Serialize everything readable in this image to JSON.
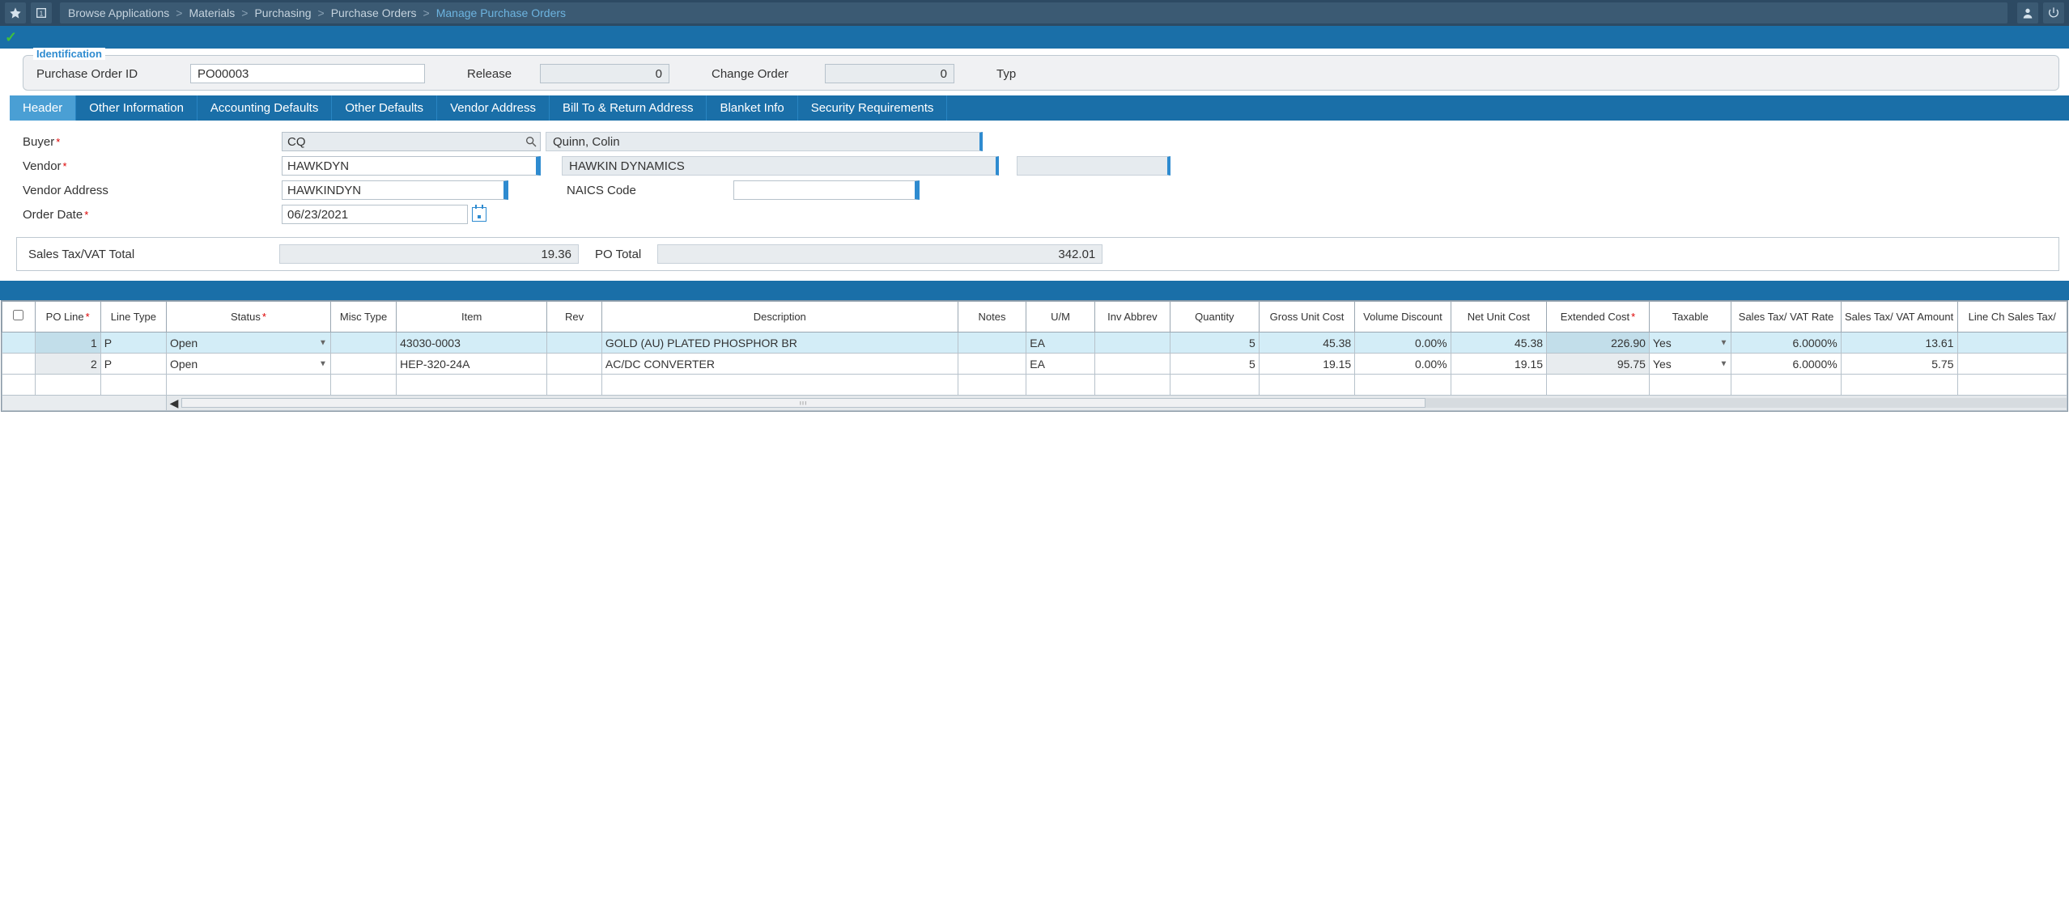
{
  "topbar": {
    "breadcrumbs": {
      "root": "Browse Applications",
      "items": [
        "Materials",
        "Purchasing",
        "Purchase Orders"
      ],
      "current": "Manage Purchase Orders"
    }
  },
  "identification": {
    "legend": "Identification",
    "po_id_label": "Purchase Order ID",
    "po_id_value": "PO00003",
    "release_label": "Release",
    "release_value": "0",
    "change_order_label": "Change Order",
    "change_order_value": "0",
    "type_label": "Typ"
  },
  "tabs": [
    "Header",
    "Other Information",
    "Accounting Defaults",
    "Other Defaults",
    "Vendor Address",
    "Bill To & Return Address",
    "Blanket Info",
    "Security Requirements"
  ],
  "form": {
    "buyer_label": "Buyer",
    "buyer_code": "CQ",
    "buyer_name": "Quinn, Colin",
    "vendor_label": "Vendor",
    "vendor_code": "HAWKDYN",
    "vendor_name": "HAWKIN DYNAMICS",
    "vendor_addr_label": "Vendor Address",
    "vendor_addr_value": "HAWKINDYN",
    "naics_label": "NAICS Code",
    "naics_value": "",
    "order_date_label": "Order Date",
    "order_date_value": "06/23/2021"
  },
  "totals": {
    "sales_tax_label": "Sales Tax/VAT Total",
    "sales_tax_value": "19.36",
    "po_total_label": "PO Total",
    "po_total_value": "342.01"
  },
  "grid": {
    "headers": {
      "po_line": "PO Line",
      "line_type": "Line Type",
      "status": "Status",
      "misc_type": "Misc Type",
      "item": "Item",
      "rev": "Rev",
      "description": "Description",
      "notes": "Notes",
      "um": "U/M",
      "inv_abbrev": "Inv Abbrev",
      "quantity": "Quantity",
      "gross_unit_cost": "Gross Unit Cost",
      "volume_discount": "Volume Discount",
      "net_unit_cost": "Net Unit Cost",
      "extended_cost": "Extended Cost",
      "taxable": "Taxable",
      "sales_tax_rate": "Sales Tax/ VAT Rate",
      "sales_tax_amount": "Sales Tax/ VAT Amount",
      "line_ch": "Line Ch Sales Tax/"
    },
    "rows": [
      {
        "po_line": "1",
        "line_type": "P",
        "status": "Open",
        "misc_type": "",
        "item": "43030-0003",
        "rev": "",
        "description": "GOLD (AU) PLATED PHOSPHOR BR",
        "notes": "",
        "um": "EA",
        "inv_abbrev": "",
        "quantity": "5",
        "gross_unit_cost": "45.38",
        "volume_discount": "0.00%",
        "net_unit_cost": "45.38",
        "extended_cost": "226.90",
        "taxable": "Yes",
        "sales_tax_rate": "6.0000%",
        "sales_tax_amount": "13.61"
      },
      {
        "po_line": "2",
        "line_type": "P",
        "status": "Open",
        "misc_type": "",
        "item": "HEP-320-24A",
        "rev": "",
        "description": "AC/DC CONVERTER",
        "notes": "",
        "um": "EA",
        "inv_abbrev": "",
        "quantity": "5",
        "gross_unit_cost": "19.15",
        "volume_discount": "0.00%",
        "net_unit_cost": "19.15",
        "extended_cost": "95.75",
        "taxable": "Yes",
        "sales_tax_rate": "6.0000%",
        "sales_tax_amount": "5.75"
      }
    ]
  }
}
